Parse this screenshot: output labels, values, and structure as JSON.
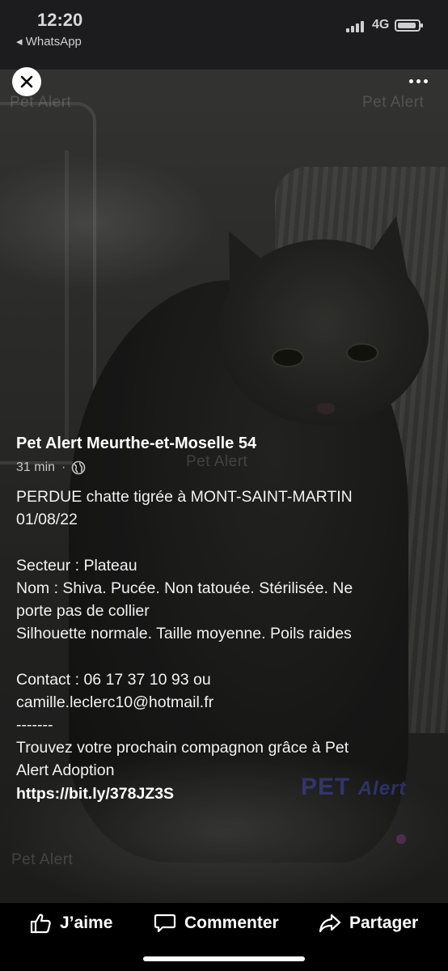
{
  "status_bar": {
    "time": "12:20",
    "back_label": "◂ WhatsApp",
    "network": "4G"
  },
  "viewer": {
    "close_icon": "close-icon",
    "more_icon": "more-horizontal-icon"
  },
  "watermarks": {
    "text": "Pet  Alert",
    "logo_word1": "PET",
    "logo_word2": "Alert"
  },
  "post": {
    "author": "Pet Alert Meurthe-et-Moselle 54",
    "time_ago": "31 min",
    "dot": "·",
    "privacy_icon": "globe-icon",
    "lines": [
      "PERDUE chatte tigrée  à MONT-SAINT-MARTIN",
      "01/08/22",
      "",
      "Secteur : Plateau",
      "Nom : Shiva. Pucée. Non tatouée. Stérilisée. Ne",
      "porte pas de collier",
      "Silhouette normale. Taille moyenne. Poils raides",
      "",
      "Contact : 06 17 37 10 93 ou",
      "camille.leclerc10@hotmail.fr",
      "-------",
      "Trouvez votre prochain compagnon grâce à Pet",
      "Alert Adoption"
    ],
    "link": "https://bit.ly/378JZ3S"
  },
  "actions": {
    "like": "J’aime",
    "comment": "Commenter",
    "share": "Partager"
  },
  "colors": {
    "status_bar_bg": "#1c1c1e",
    "background": "#000000",
    "text": "#ffffff",
    "meta_text": "#c6c6c6"
  }
}
